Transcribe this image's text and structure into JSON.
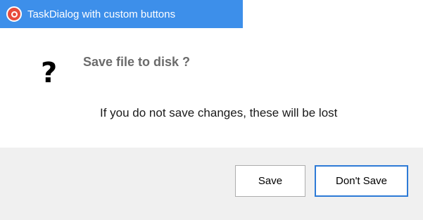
{
  "window": {
    "title": "TaskDialog with custom buttons",
    "app_icon": "app-icon",
    "accent_color": "#3d8fea"
  },
  "dialog": {
    "icon": "question-icon",
    "icon_glyph": "?",
    "main_instruction": "Save file to disk ?",
    "content": "If you do not save changes, these will be lost"
  },
  "buttons": {
    "save_label": "Save",
    "dont_save_label": "Don't Save",
    "default_button": "Don't Save"
  }
}
